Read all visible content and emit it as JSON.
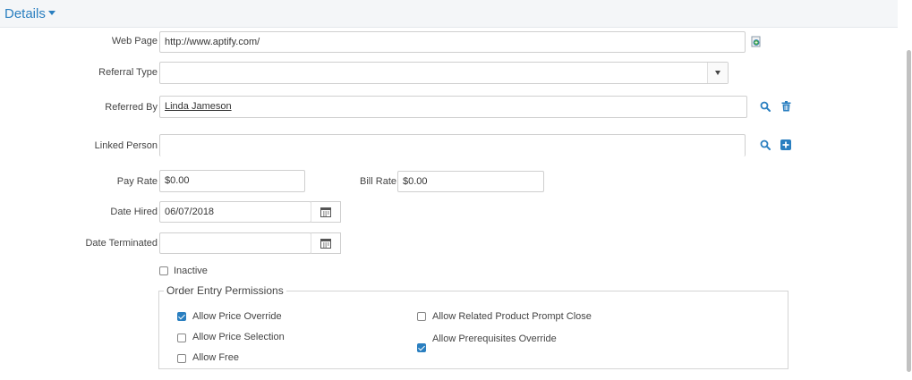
{
  "section": {
    "title": "Details"
  },
  "web_page": {
    "label": "Web Page",
    "value": "http://www.aptify.com/"
  },
  "referral_type": {
    "label": "Referral Type",
    "value": ""
  },
  "referred_by": {
    "label": "Referred By",
    "value": "Linda Jameson"
  },
  "linked_person": {
    "label": "Linked Person",
    "value": ""
  },
  "pay_rate": {
    "label": "Pay Rate",
    "value": "$0.00"
  },
  "bill_rate": {
    "label": "Bill Rate",
    "value": "$0.00"
  },
  "date_hired": {
    "label": "Date Hired",
    "value": "06/07/2018"
  },
  "date_terminated": {
    "label": "Date Terminated",
    "value": ""
  },
  "inactive": {
    "label": "Inactive",
    "checked": false
  },
  "permissions": {
    "legend": "Order Entry Permissions",
    "allow_price_override": {
      "label": "Allow Price Override",
      "checked": true
    },
    "allow_price_selection": {
      "label": "Allow Price Selection",
      "checked": false
    },
    "allow_free": {
      "label": "Allow Free",
      "checked": false
    },
    "allow_related_product_prompt_close": {
      "label": "Allow Related Product Prompt Close",
      "checked": false
    },
    "allow_prerequisites_override": {
      "label": "Allow Prerequisites Override",
      "checked": true
    }
  },
  "colors": {
    "accent": "#2a7fc0",
    "header_bg": "#f4f6f8",
    "border": "#cfcfcf"
  }
}
